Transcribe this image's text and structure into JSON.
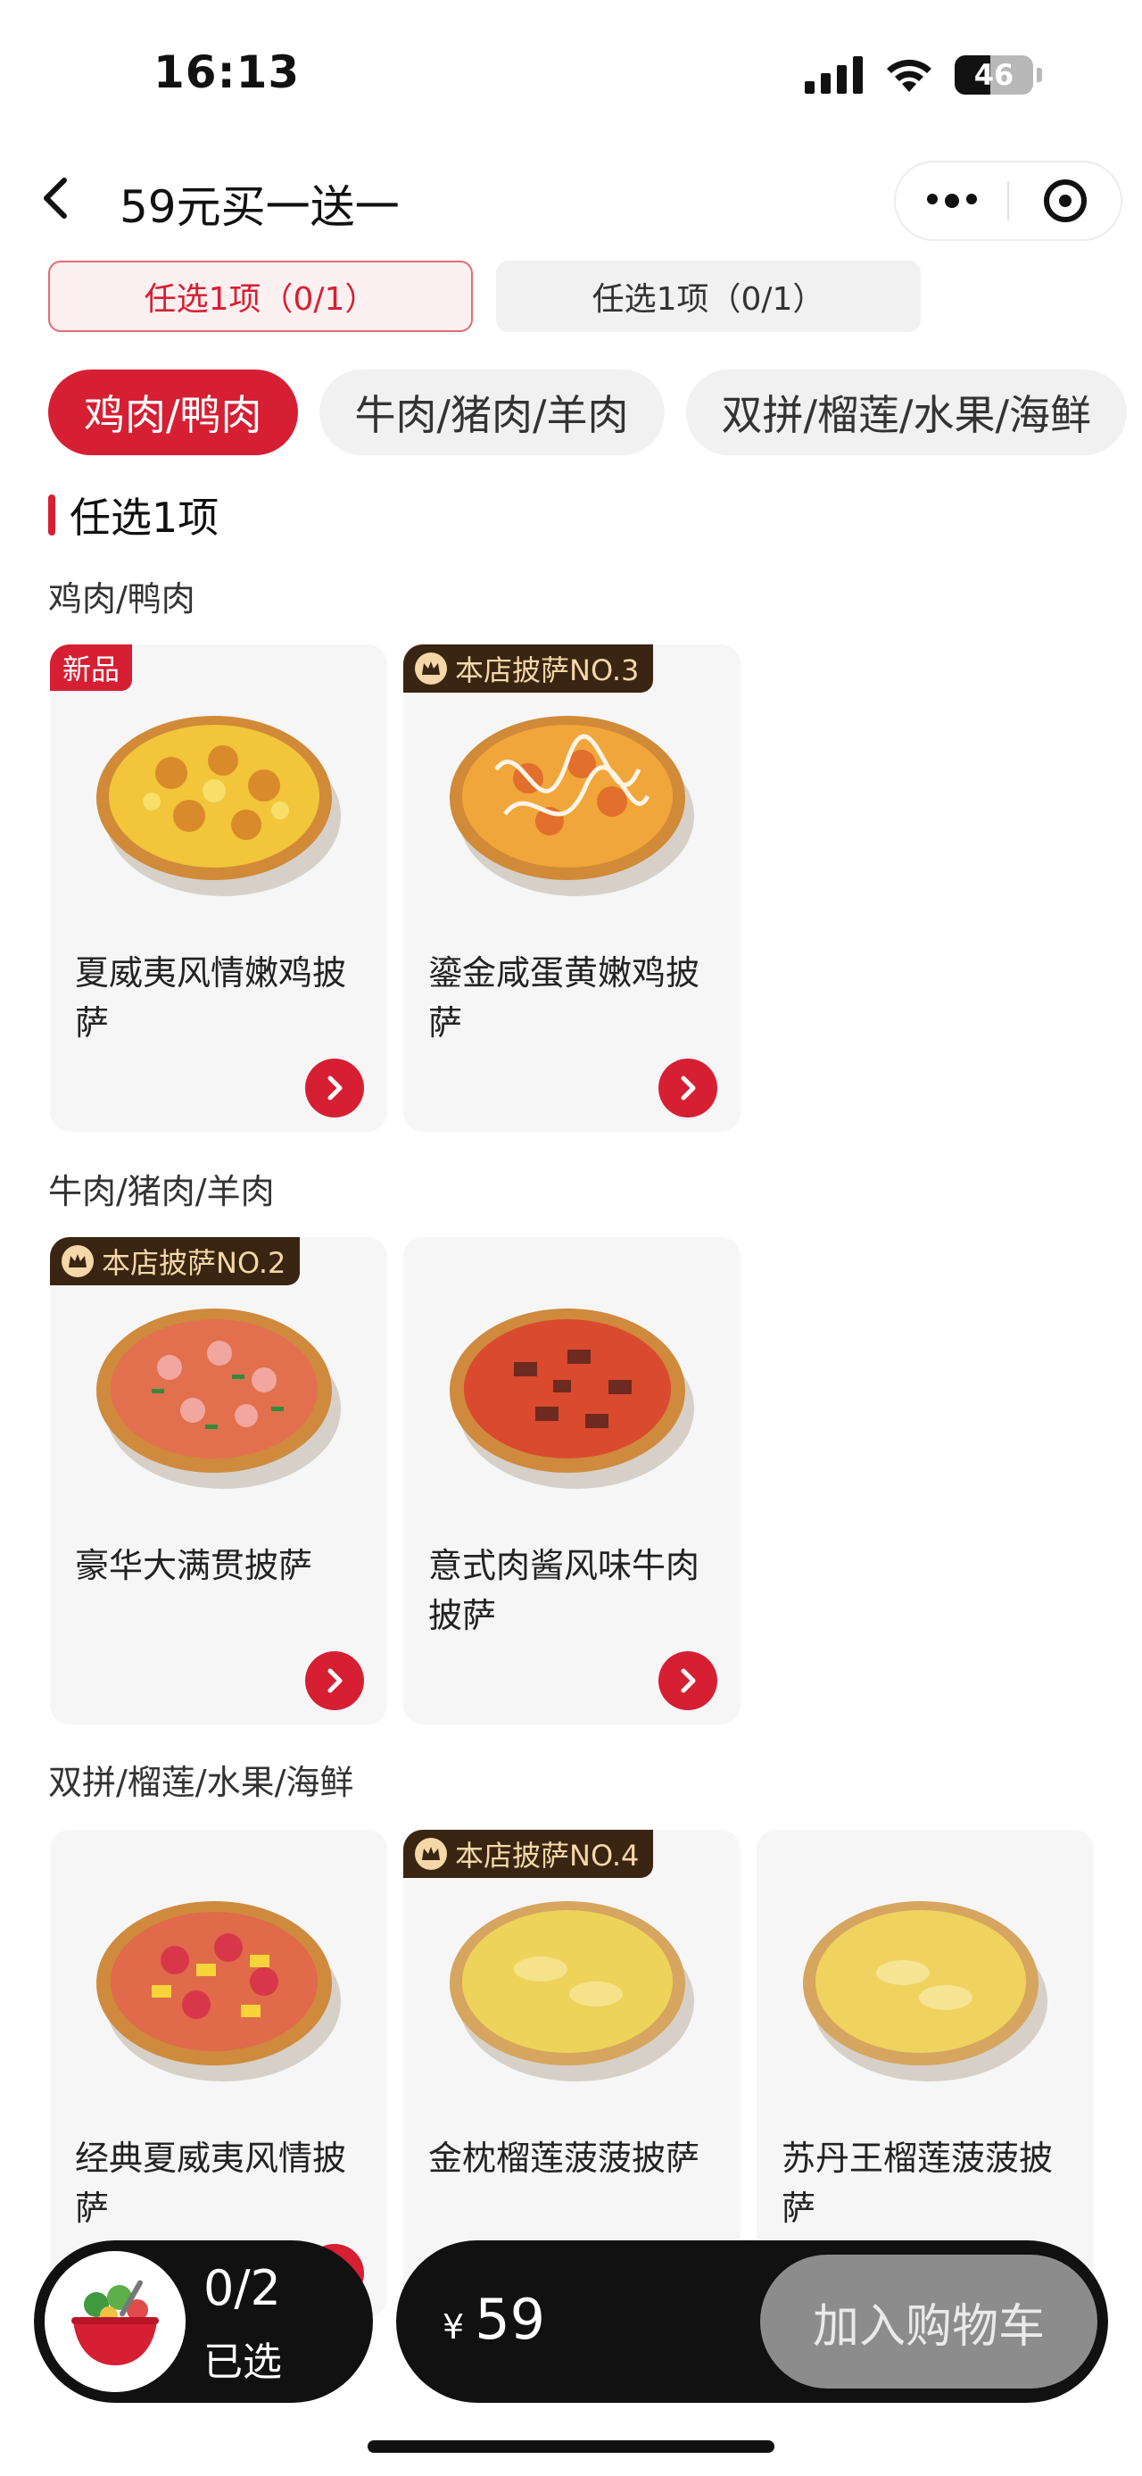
{
  "status_bar": {
    "time": "16:13",
    "battery_level": "46",
    "battery_fraction": 0.46
  },
  "nav": {
    "title": "59元买一送一",
    "back_icon": "chevron-left-icon",
    "more_icon": "more-dots-icon",
    "close_icon": "target-icon"
  },
  "steps": [
    {
      "label": "任选1项（0/1）",
      "active": true
    },
    {
      "label": "任选1项（0/1）",
      "active": false
    }
  ],
  "categories": [
    {
      "label": "鸡肉/鸭肉",
      "active": true
    },
    {
      "label": "牛肉/猪肉/羊肉",
      "active": false
    },
    {
      "label": "双拼/榴莲/水果/海鲜",
      "active": false
    }
  ],
  "section_title": "任选1项",
  "groups": [
    {
      "label": "鸡肉/鸭肉",
      "items": [
        {
          "name": "夏威夷风情嫩鸡披萨",
          "badge": "新品",
          "badge_type": "new"
        },
        {
          "name": "鎏金咸蛋黄嫩鸡披萨",
          "badge": "本店披萨NO.3",
          "badge_type": "rank"
        }
      ]
    },
    {
      "label": "牛肉/猪肉/羊肉",
      "items": [
        {
          "name": "豪华大满贯披萨",
          "badge": "本店披萨NO.2",
          "badge_type": "rank"
        },
        {
          "name": "意式肉酱风味牛肉披萨",
          "badge": "",
          "badge_type": ""
        }
      ]
    },
    {
      "label": "双拼/榴莲/水果/海鲜",
      "items": [
        {
          "name": "经典夏威夷风情披萨",
          "badge": "",
          "badge_type": ""
        },
        {
          "name": "金枕榴莲菠菠披萨",
          "badge": "本店披萨NO.4",
          "badge_type": "rank"
        },
        {
          "name": "苏丹王榴莲菠菠披萨",
          "badge": "",
          "badge_type": ""
        }
      ]
    }
  ],
  "bottom_bar": {
    "selected_count": "0/2",
    "selected_label": "已选",
    "currency": "¥",
    "price": "59",
    "add_to_cart": "加入购物车"
  },
  "colors": {
    "accent": "#d61f33",
    "dark": "#111111",
    "card_bg": "#f6f6f6",
    "rank_badge": "#3a2412"
  }
}
